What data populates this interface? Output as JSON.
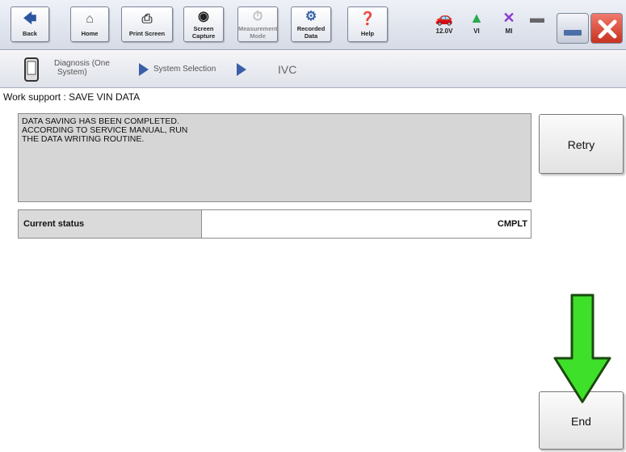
{
  "toolbar": {
    "back_label": "Back",
    "home_label": "Home",
    "print_label": "Print Screen",
    "capture_label_1": "Screen",
    "capture_label_2": "Capture",
    "measurement_label_1": "Measurement",
    "measurement_label_2": "Mode",
    "recorded_label_1": "Recorded",
    "recorded_label_2": "Data",
    "help_label": "Help",
    "icons": {
      "back": "back-arrow-icon",
      "home": "home-icon",
      "print": "printer-icon",
      "capture": "camera-icon",
      "measurement": "meter-icon",
      "recorded": "recorded-data-icon",
      "help": "help-icon"
    }
  },
  "status": {
    "voltage": "12.0V",
    "vi_label": "VI",
    "mi_label": "MI",
    "icons": {
      "voltage": "car-battery-icon",
      "vi": "signal-icon",
      "mi": "x-mark-icon",
      "battery": "battery-icon"
    },
    "colors": {
      "vi": "#2aa84a",
      "mi": "#8a3ad0",
      "car": "#3b72c9"
    }
  },
  "breadcrumb": {
    "item1_line1": "Diagnosis (One",
    "item1_line2": "System)",
    "item2": "System Selection",
    "item3": "IVC"
  },
  "work": {
    "title": "Work support : SAVE VIN DATA",
    "message_line1": "DATA SAVING HAS BEEN COMPLETED.",
    "message_line2": "ACCORDING TO SERVICE MANUAL, RUN",
    "message_line3": "THE DATA WRITING ROUTINE.",
    "status_label": "Current status",
    "status_value": "CMPLT",
    "retry_label": "Retry",
    "end_label": "End"
  },
  "annotation": {
    "arrow_color": "#3fe02a"
  }
}
